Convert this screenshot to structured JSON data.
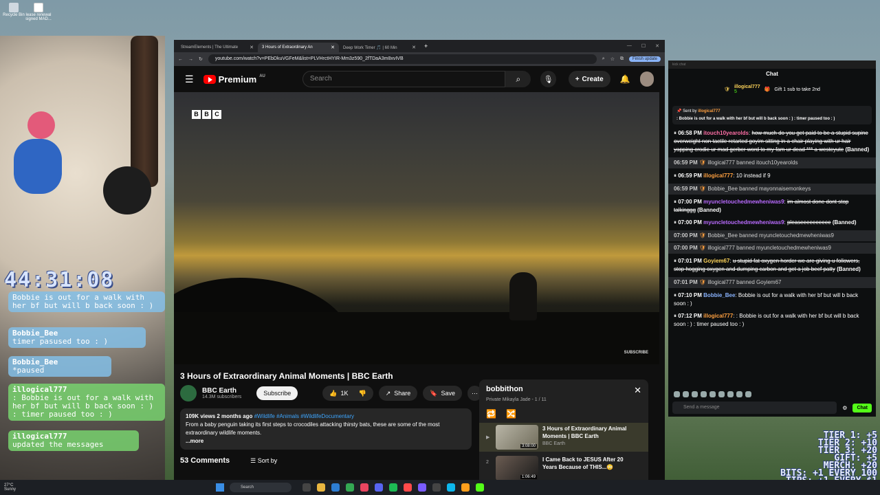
{
  "desktop": {
    "icons": [
      "Recycle Bin",
      "lease renewal signed MAD..."
    ]
  },
  "overlay": {
    "timer": "44:31:08",
    "messages": [
      {
        "name": "Bobbie_Bee",
        "text": "Bobbie is out for a walk with her bf but will b back soon : )",
        "style": "blue"
      },
      {
        "name": "Bobbie_Bee",
        "text": "timer pasused too : )",
        "style": "blue"
      },
      {
        "name": "Bobbie_Bee",
        "text": "*paused",
        "style": "blue"
      },
      {
        "name": "illogical777",
        "text": ": Bobbie is out for a walk with her bf but will b back soon : ) : timer paused too : )",
        "style": "green"
      },
      {
        "name": "illogical777",
        "text": "updated the messages",
        "style": "green"
      }
    ],
    "tiers": [
      "TIER 1: +5",
      "TIER 2: +10",
      "TIER 3: +20",
      "GIFT: +5",
      "MERCH: +20",
      "BITS: +1 EVERY 100",
      "TIPS: +1 EVERY $1"
    ]
  },
  "browser": {
    "tabs": [
      {
        "label": "StreamElements | The Ultimate",
        "active": false
      },
      {
        "label": "3 Hours of Extraordinary An",
        "active": true
      },
      {
        "label": "Deep Work Timer 🎵 | 60 Min",
        "active": false
      }
    ],
    "new_tab": "+",
    "url": "youtube.com/watch?v=PEbDkuVGFeM&list=PLVHrctHYIR-Mm3z590_2fTDaA3m8xvIVB",
    "finish_update": "Finish update"
  },
  "youtube": {
    "logo": "Premium",
    "region": "AU",
    "search_placeholder": "Search",
    "create_label": "Create",
    "video": {
      "bbc_letters": [
        "B",
        "B",
        "C"
      ],
      "watermark": "SUBSCRIBE",
      "title": "3 Hours of Extraordinary Animal Moments | BBC Earth",
      "channel": "BBC Earth",
      "subscribers": "14.3M subscribers",
      "subscribe_label": "Subscribe",
      "likes": "1K",
      "share_label": "Share",
      "save_label": "Save",
      "views_date": "109K views  2 months ago",
      "hashtags": "#Wildlife #Animals #WildlifeDocumentary",
      "description": "From a baby penguin taking its first steps to crocodiles attacking thirsty bats, these are some of the most extraordinary wildlife moments.",
      "more": "...more",
      "comments": "53 Comments",
      "sort_by": "Sort by"
    },
    "playlist": {
      "title": "bobbithon",
      "meta": "Private  Mikayla Jade - 1 / 11",
      "items": [
        {
          "index": "▶",
          "title": "3 Hours of Extraordinary Animal Moments | BBC Earth",
          "channel": "BBC Earth",
          "duration": "3:08:00"
        },
        {
          "index": "2",
          "title": "I Came Back to JESUS After 20 Years Because of THIS...😳",
          "channel": "",
          "duration": "1:06:49"
        }
      ]
    }
  },
  "chat": {
    "top_label": "kick chat",
    "header": "Chat",
    "gift": {
      "user": "illogical777",
      "count": "5",
      "text": "Gift 1 sub to take 2nd"
    },
    "pinned": {
      "sent_by": "Sent by",
      "user": "illogical777",
      "text": ": Bobbie is out for a walk with her bf but will b back soon : ) : timer paused too : )"
    },
    "messages": [
      {
        "kind": "msg",
        "time": "06:58 PM",
        "user": "itouch10yearolds",
        "color": "pink",
        "text": "how much do you get paid to be a stupid supine overweight non tactile retarted goyim sitting in a chair playing with ur hair yapping crodie ur mad gerber word to my fam ur dead *** a westeyute",
        "struck": true,
        "suffix": "(Banned)"
      },
      {
        "kind": "sys",
        "time": "06:59 PM",
        "text": "illogical777 banned itouch10yearolds"
      },
      {
        "kind": "msg",
        "time": "06:59 PM",
        "user": "illogical777",
        "color": "orange",
        "text": "10 instead if 9",
        "struck": false,
        "suffix": ""
      },
      {
        "kind": "sys",
        "time": "06:59 PM",
        "text": "Bobbie_Bee banned mayonnaisemonkeys"
      },
      {
        "kind": "msg",
        "time": "07:00 PM",
        "user": "myuncletouchedmewheniwas9",
        "color": "purple",
        "text": "im almost done dont stop talkinggg",
        "struck": true,
        "suffix": "(Banned)"
      },
      {
        "kind": "msg",
        "time": "07:00 PM",
        "user": "myuncletouchedmewheniwas9",
        "color": "purple",
        "text": "pleaseeeeeeeeee",
        "struck": true,
        "suffix": "(Banned)"
      },
      {
        "kind": "sys",
        "time": "07:00 PM",
        "text": "Bobbie_Bee banned myuncletouchedmewheniwas9"
      },
      {
        "kind": "sys",
        "time": "07:00 PM",
        "text": "illogical777 banned myuncletouchedmewheniwas9"
      },
      {
        "kind": "msg",
        "time": "07:01 PM",
        "user": "Goyiem67",
        "color": "yellow",
        "text": "u stupid fat oxygen horder we are giving u followers, stop hogging oxygen and dumping carbon and get a job beef patty",
        "struck": true,
        "suffix": "(Banned)"
      },
      {
        "kind": "sys",
        "time": "07:01 PM",
        "text": "illogical777 banned Goyiem67"
      },
      {
        "kind": "msg",
        "time": "07:10 PM",
        "user": "Bobbie_Bee",
        "color": "blue",
        "text": "Bobbie is out for a walk with her bf but will b back soon : )",
        "struck": false,
        "suffix": ""
      },
      {
        "kind": "msg",
        "time": "07:12 PM",
        "user": "illogical777",
        "color": "orange",
        "text": ": Bobbie is out for a walk with her bf but will b back soon : ) : timer paused too : )",
        "struck": false,
        "suffix": ""
      }
    ],
    "input_placeholder": "Send a message",
    "send_label": "Chat"
  },
  "taskbar": {
    "weather_temp": "27°C",
    "weather_desc": "Sunny",
    "search_placeholder": "Search"
  }
}
